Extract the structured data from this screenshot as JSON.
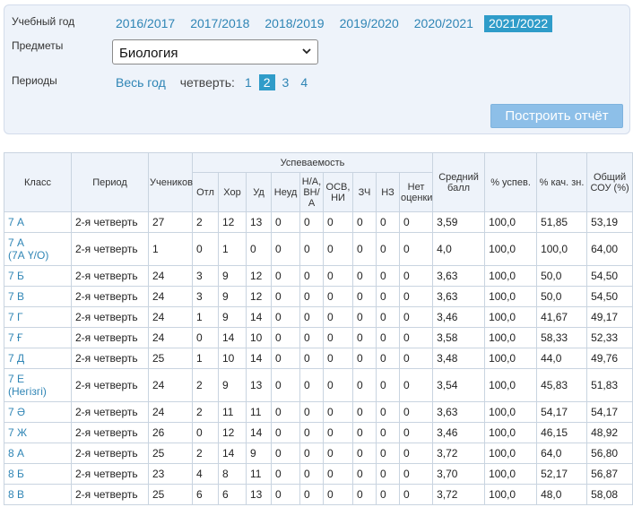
{
  "filters": {
    "year_label": "Учебный год",
    "years": [
      {
        "label": "2016/2017",
        "active": false
      },
      {
        "label": "2017/2018",
        "active": false
      },
      {
        "label": "2018/2019",
        "active": false
      },
      {
        "label": "2019/2020",
        "active": false
      },
      {
        "label": "2020/2021",
        "active": false
      },
      {
        "label": "2021/2022",
        "active": true
      }
    ],
    "subject_label": "Предметы",
    "subject_value": "Биология",
    "periods_label": "Периоды",
    "whole_year": "Весь год",
    "quarter_label": "четверть:",
    "quarters": [
      {
        "label": "1",
        "active": false
      },
      {
        "label": "2",
        "active": true
      },
      {
        "label": "3",
        "active": false
      },
      {
        "label": "4",
        "active": false
      }
    ],
    "build_button": "Построить отчёт"
  },
  "table": {
    "headers": {
      "class": "Класс",
      "period": "Период",
      "students": "Учеников",
      "progress_group": "Успеваемость",
      "sub": [
        "Отл",
        "Хор",
        "Уд",
        "Неуд",
        "Н/А, ВН/А",
        "ОСВ, НИ",
        "ЗЧ",
        "НЗ",
        "Нет оценки"
      ],
      "avg": "Средний балл",
      "pct_success": "% успев.",
      "pct_quality": "% кач. зн.",
      "sou": "Общий СОУ (%)"
    },
    "rows": [
      {
        "cls": [
          "7 А"
        ],
        "period": "2-я четверть",
        "students": "27",
        "vals": [
          "2",
          "12",
          "13",
          "0",
          "0",
          "0",
          "0",
          "0",
          "0"
        ],
        "avg": "3,59",
        "success": "100,0",
        "quality": "51,85",
        "sou": "53,19"
      },
      {
        "cls": [
          "7 А",
          "(7А Ү/О)"
        ],
        "period": "2-я четверть",
        "students": "1",
        "vals": [
          "0",
          "1",
          "0",
          "0",
          "0",
          "0",
          "0",
          "0",
          "0"
        ],
        "avg": "4,0",
        "success": "100,0",
        "quality": "100,0",
        "sou": "64,00"
      },
      {
        "cls": [
          "7 Б"
        ],
        "period": "2-я четверть",
        "students": "24",
        "vals": [
          "3",
          "9",
          "12",
          "0",
          "0",
          "0",
          "0",
          "0",
          "0"
        ],
        "avg": "3,63",
        "success": "100,0",
        "quality": "50,0",
        "sou": "54,50"
      },
      {
        "cls": [
          "7 В"
        ],
        "period": "2-я четверть",
        "students": "24",
        "vals": [
          "3",
          "9",
          "12",
          "0",
          "0",
          "0",
          "0",
          "0",
          "0"
        ],
        "avg": "3,63",
        "success": "100,0",
        "quality": "50,0",
        "sou": "54,50"
      },
      {
        "cls": [
          "7 Г"
        ],
        "period": "2-я четверть",
        "students": "24",
        "vals": [
          "1",
          "9",
          "14",
          "0",
          "0",
          "0",
          "0",
          "0",
          "0"
        ],
        "avg": "3,46",
        "success": "100,0",
        "quality": "41,67",
        "sou": "49,17"
      },
      {
        "cls": [
          "7 Ғ"
        ],
        "period": "2-я четверть",
        "students": "24",
        "vals": [
          "0",
          "14",
          "10",
          "0",
          "0",
          "0",
          "0",
          "0",
          "0"
        ],
        "avg": "3,58",
        "success": "100,0",
        "quality": "58,33",
        "sou": "52,33"
      },
      {
        "cls": [
          "7 Д"
        ],
        "period": "2-я четверть",
        "students": "25",
        "vals": [
          "1",
          "10",
          "14",
          "0",
          "0",
          "0",
          "0",
          "0",
          "0"
        ],
        "avg": "3,48",
        "success": "100,0",
        "quality": "44,0",
        "sou": "49,76"
      },
      {
        "cls": [
          "7 Е",
          "(Негізгі)"
        ],
        "period": "2-я четверть",
        "students": "24",
        "vals": [
          "2",
          "9",
          "13",
          "0",
          "0",
          "0",
          "0",
          "0",
          "0"
        ],
        "avg": "3,54",
        "success": "100,0",
        "quality": "45,83",
        "sou": "51,83"
      },
      {
        "cls": [
          "7 Ә"
        ],
        "period": "2-я четверть",
        "students": "24",
        "vals": [
          "2",
          "11",
          "11",
          "0",
          "0",
          "0",
          "0",
          "0",
          "0"
        ],
        "avg": "3,63",
        "success": "100,0",
        "quality": "54,17",
        "sou": "54,17"
      },
      {
        "cls": [
          "7 Ж"
        ],
        "period": "2-я четверть",
        "students": "26",
        "vals": [
          "0",
          "12",
          "14",
          "0",
          "0",
          "0",
          "0",
          "0",
          "0"
        ],
        "avg": "3,46",
        "success": "100,0",
        "quality": "46,15",
        "sou": "48,92"
      },
      {
        "cls": [
          "8 А"
        ],
        "period": "2-я четверть",
        "students": "25",
        "vals": [
          "2",
          "14",
          "9",
          "0",
          "0",
          "0",
          "0",
          "0",
          "0"
        ],
        "avg": "3,72",
        "success": "100,0",
        "quality": "64,0",
        "sou": "56,80"
      },
      {
        "cls": [
          "8 Б"
        ],
        "period": "2-я четверть",
        "students": "23",
        "vals": [
          "4",
          "8",
          "11",
          "0",
          "0",
          "0",
          "0",
          "0",
          "0"
        ],
        "avg": "3,70",
        "success": "100,0",
        "quality": "52,17",
        "sou": "56,87"
      },
      {
        "cls": [
          "8 В"
        ],
        "period": "2-я четверть",
        "students": "25",
        "vals": [
          "6",
          "6",
          "13",
          "0",
          "0",
          "0",
          "0",
          "0",
          "0"
        ],
        "avg": "3,72",
        "success": "100,0",
        "quality": "48,0",
        "sou": "58,08"
      }
    ]
  }
}
